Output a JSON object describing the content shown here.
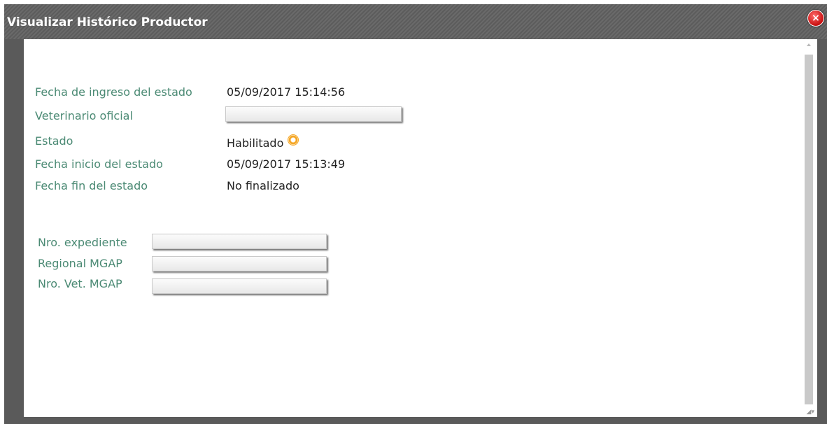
{
  "window": {
    "title": "Visualizar Histórico Productor",
    "close_label": "×"
  },
  "details": {
    "fecha_ingreso_label": "Fecha de ingreso del estado",
    "fecha_ingreso_value": "05/09/2017 15:14:56",
    "veterinario_label": "Veterinario oficial",
    "estado_label": "Estado",
    "estado_value": "Habilitado",
    "fecha_inicio_label": "Fecha inicio del estado",
    "fecha_inicio_value": "05/09/2017 15:13:49",
    "fecha_fin_label": "Fecha fin del estado",
    "fecha_fin_value": "No finalizado"
  },
  "expediente": {
    "nro_expediente_label": "Nro. expediente",
    "regional_label": "Regional MGAP",
    "nro_vet_label": "Nro. Vet. MGAP"
  },
  "resize_grip": "◢▾"
}
